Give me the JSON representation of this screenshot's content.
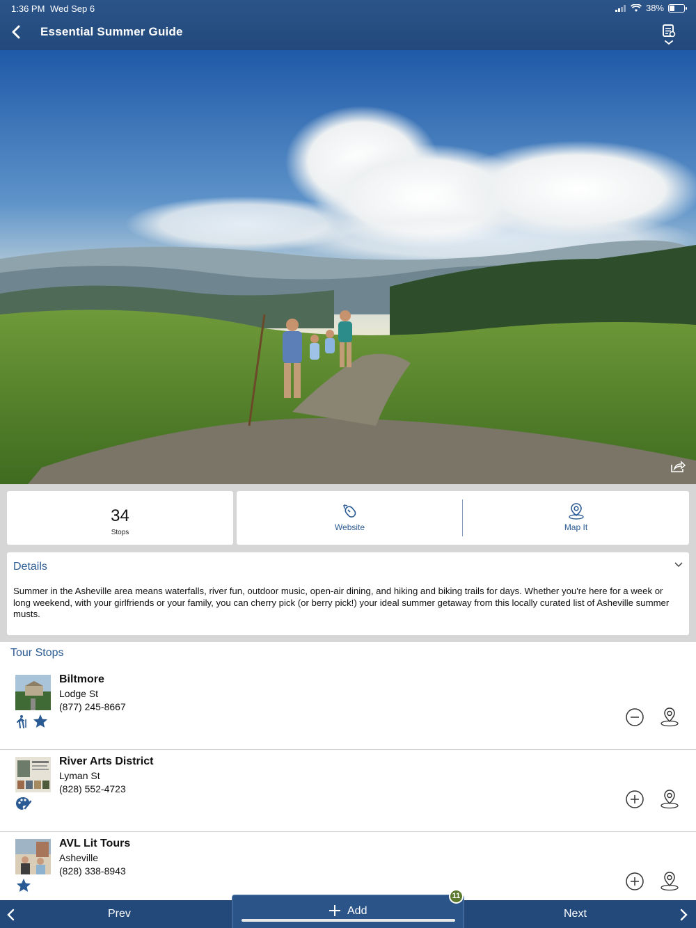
{
  "status_bar": {
    "time": "1:36 PM",
    "date": "Wed Sep 6",
    "battery": "38%",
    "battery_level": 0.38
  },
  "header": {
    "title": "Essential Summer Guide",
    "back_icon": "chevron-left-icon",
    "menu_icon": "list-location-menu-icon"
  },
  "hero": {
    "share_icon": "share-icon"
  },
  "stats": {
    "count": "34",
    "count_label": "Stops",
    "website_label": "Website",
    "map_label": "Map It"
  },
  "details": {
    "title": "Details",
    "text": "Summer in the Asheville area means waterfalls, river fun, outdoor music, open-air dining, and hiking and biking trails for days. Whether you're here for a week or long weekend, with your girlfriends or your family, you can cherry pick (or berry pick!) your ideal summer getaway from this locally curated list of Asheville summer musts."
  },
  "tour": {
    "title": "Tour Stops",
    "stops": [
      {
        "name": "Biltmore",
        "address": "Lodge St",
        "phone": "(877) 245-8667",
        "category_icons": [
          "hiking-icon",
          "star-icon"
        ],
        "action": "remove"
      },
      {
        "name": "River Arts District",
        "address": "Lyman St",
        "phone": "(828) 552-4723",
        "category_icons": [
          "palette-icon"
        ],
        "action": "add"
      },
      {
        "name": "AVL Lit Tours",
        "address": "Asheville",
        "phone": "(828) 338-8943",
        "category_icons": [
          "star-icon"
        ],
        "action": "add"
      }
    ]
  },
  "bottom_bar": {
    "prev_label": "Prev",
    "add_label": "Add",
    "next_label": "Next",
    "badge_count": "11"
  },
  "colors": {
    "header_bg": "#23497b",
    "accent_blue": "#2a5a93",
    "badge_green": "#5b7a2e",
    "info_bg": "#d6d6d6"
  }
}
